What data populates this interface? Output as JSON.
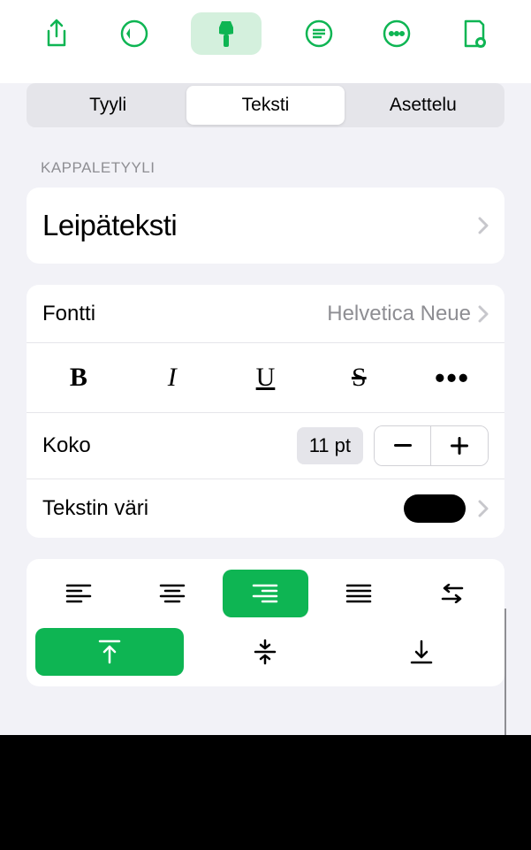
{
  "accent": "#0eb553",
  "tabs": {
    "style": "Tyyli",
    "text": "Teksti",
    "layout": "Asettelu"
  },
  "section": {
    "paragraph_style": "KAPPALETYYLI"
  },
  "paragraph": {
    "style_name": "Leipäteksti"
  },
  "font": {
    "label": "Fontti",
    "value": "Helvetica Neue"
  },
  "size": {
    "label": "Koko",
    "value": "11 pt"
  },
  "text_color": {
    "label": "Tekstin väri",
    "value": "#000000"
  }
}
